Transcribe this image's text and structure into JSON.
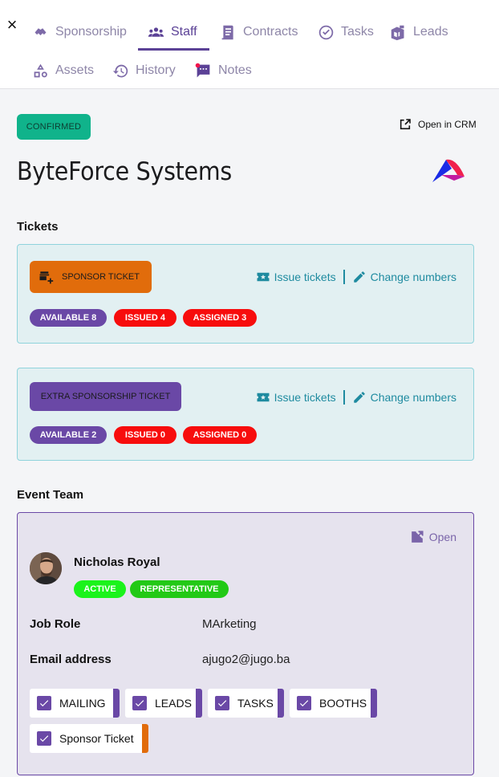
{
  "header": {
    "close_label": "×",
    "tabs": [
      {
        "label": "Sponsorship",
        "icon": "handshake-icon"
      },
      {
        "label": "Staff",
        "icon": "people-icon",
        "active": true
      },
      {
        "label": "Contracts",
        "icon": "contract-icon"
      },
      {
        "label": "Tasks",
        "icon": "check-circle-icon"
      },
      {
        "label": "Leads",
        "icon": "leads-icon"
      },
      {
        "label": "Assets",
        "icon": "shapes-icon"
      },
      {
        "label": "History",
        "icon": "history-icon"
      },
      {
        "label": "Notes",
        "icon": "notes-icon",
        "notification": true
      }
    ]
  },
  "company": {
    "status": "CONFIRMED",
    "open_crm": "Open in CRM",
    "name": "ByteForce Systems"
  },
  "tickets": {
    "section_title": "Tickets",
    "cards": [
      {
        "type_label": "SPONSOR TICKET",
        "issue_label": "Issue tickets",
        "change_label": "Change numbers",
        "available": "AVAILABLE 8",
        "issued": "ISSUED 4",
        "assigned": "ASSIGNED 3"
      },
      {
        "type_label": "EXTRA SPONSORSHIP TICKET",
        "issue_label": "Issue tickets",
        "change_label": "Change numbers",
        "available": "AVAILABLE 2",
        "issued": "ISSUED 0",
        "assigned": "ASSIGNED 0"
      }
    ]
  },
  "team": {
    "section_title": "Event Team",
    "open_label": "Open",
    "member": {
      "name": "Nicholas Royal",
      "status": "ACTIVE",
      "role_badge": "REPRESENTATIVE",
      "job_role_label": "Job Role",
      "job_role_value": "MArketing",
      "email_label": "Email address",
      "email_value": "ajugo2@jugo.ba"
    },
    "permissions": [
      "MAILING",
      "LEADS",
      "TASKS",
      "BOOTHS",
      "Sponsor Ticket"
    ]
  },
  "colors": {
    "accent": "#5b4196",
    "confirmed": "#10b38b",
    "sponsor_orange": "#e16c0b",
    "teal": "#1f8ba0",
    "red": "#f70d0d"
  }
}
